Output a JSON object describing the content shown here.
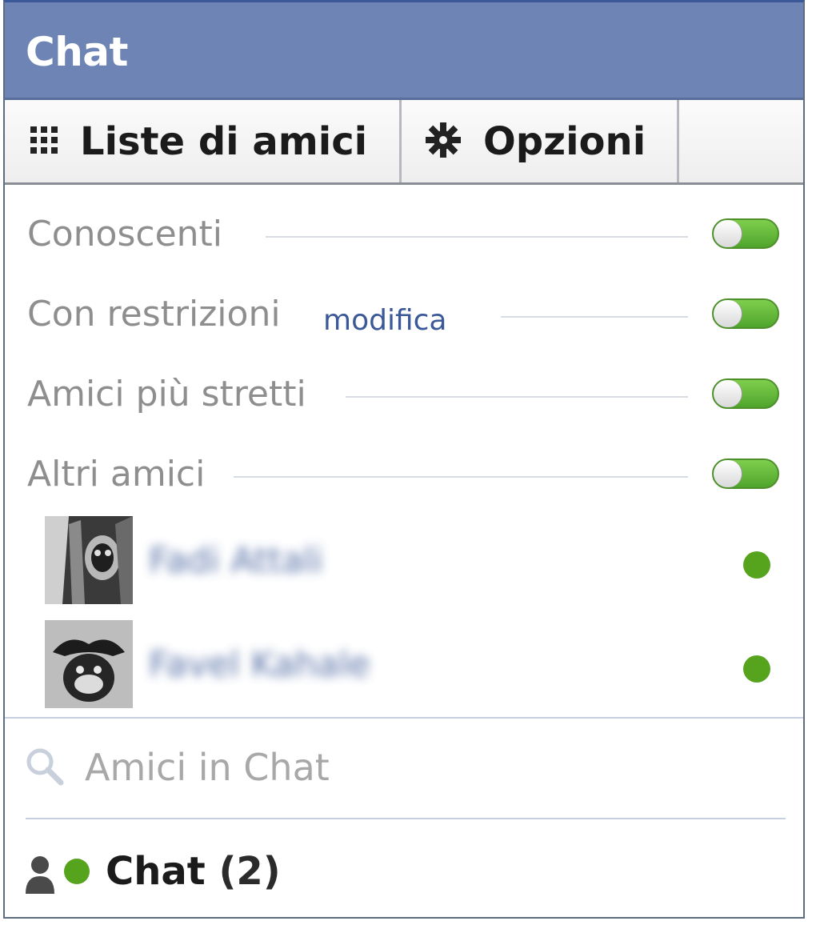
{
  "header": {
    "title": "Chat"
  },
  "tabs": {
    "lists_label": "Liste di amici",
    "options_label": "Opzioni"
  },
  "friend_lists": [
    {
      "name": "Conoscenti",
      "enabled": true
    },
    {
      "name": "Con restrizioni",
      "edit_label": "modifica",
      "enabled": true
    },
    {
      "name": "Amici più stretti",
      "enabled": true
    },
    {
      "name": "Altri amici",
      "enabled": true
    }
  ],
  "online_friends": [
    {
      "name": "Fadi Attali",
      "avatar": "avatar-photo",
      "status": "online"
    },
    {
      "name": "Favel Kahale",
      "avatar": "avatar-photo",
      "status": "online"
    }
  ],
  "search": {
    "placeholder": "Amici in Chat",
    "value": ""
  },
  "footer": {
    "label": "Chat",
    "count": "(2)"
  },
  "colors": {
    "header_bg": "#6d84b4",
    "link": "#3b5998",
    "online_green": "#56a31e",
    "toggle_green": "#6cc043"
  }
}
